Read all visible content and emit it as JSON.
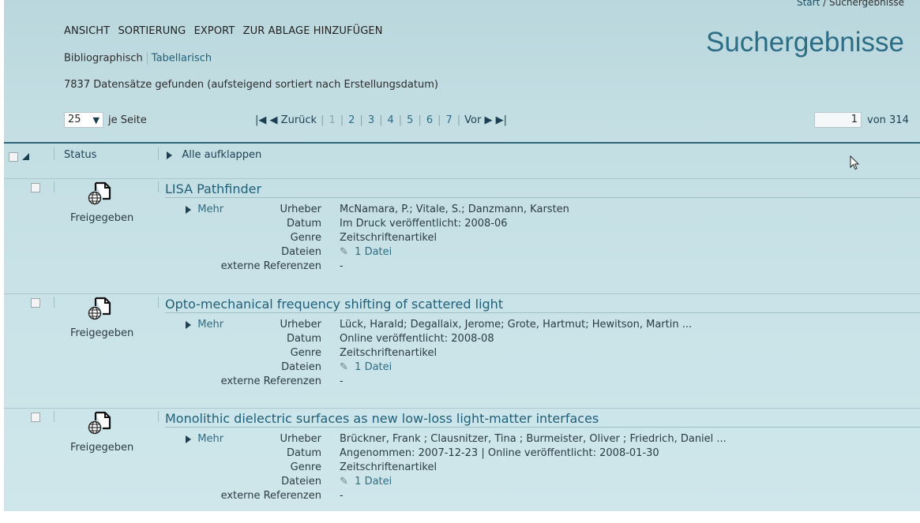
{
  "breadcrumb": {
    "home": "Start",
    "separator": "/",
    "current": "Suchergebnisse"
  },
  "page_title": "Suchergebnisse",
  "menu": [
    "ANSICHT",
    "SORTIERUNG",
    "EXPORT",
    "ZUR ABLAGE HINZUFÜGEN"
  ],
  "views": {
    "bibliographic": "Bibliographisch",
    "tabular": "Tabellarisch"
  },
  "result_count": "7837 Datensätze gefunden (aufsteigend sortiert nach Erstellungsdatum)",
  "per_page": {
    "value": "25",
    "label": "je Seite"
  },
  "pager": {
    "prev": "Zurück",
    "next": "Vor",
    "pages": [
      "1",
      "2",
      "3",
      "4",
      "5",
      "6",
      "7"
    ],
    "current": "1",
    "page_input": "1",
    "of_label": "von",
    "total_pages": "314"
  },
  "list_header": {
    "status": "Status",
    "expand_all": "Alle aufklappen"
  },
  "labels": {
    "mehr": "Mehr",
    "creator": "Urheber",
    "date": "Datum",
    "genre": "Genre",
    "files": "Dateien",
    "external": "externe Referenzen"
  },
  "results": [
    {
      "status": "Freigegeben",
      "title": "LISA Pathfinder",
      "creator": "McNamara, P.; Vitale, S.; Danzmann, Karsten",
      "date": "Im Druck veröffentlicht: 2008-06",
      "genre": "Zeitschriftenartikel",
      "files": "1 Datei",
      "external": "-"
    },
    {
      "status": "Freigegeben",
      "title": "Opto-mechanical frequency shifting of scattered light",
      "creator": "Lück, Harald; Degallaix, Jerome; Grote, Hartmut; Hewitson, Martin ...",
      "date": "Online veröffentlicht: 2008-08",
      "genre": "Zeitschriftenartikel",
      "files": "1 Datei",
      "external": "-"
    },
    {
      "status": "Freigegeben",
      "title": "Monolithic dielectric surfaces as new low-loss light-matter interfaces",
      "creator": "Brückner, Frank ; Clausnitzer, Tina ; Burmeister, Oliver ; Friedrich, Daniel ...",
      "date": "Angenommen: 2007-12-23 | Online veröffentlicht: 2008-01-30",
      "genre": "Zeitschriftenartikel",
      "files": "1 Datei",
      "external": "-"
    }
  ],
  "icons": {
    "document": "document-globe-icon",
    "attachment": "paperclip-icon",
    "cursor": "mouse-pointer-icon"
  }
}
